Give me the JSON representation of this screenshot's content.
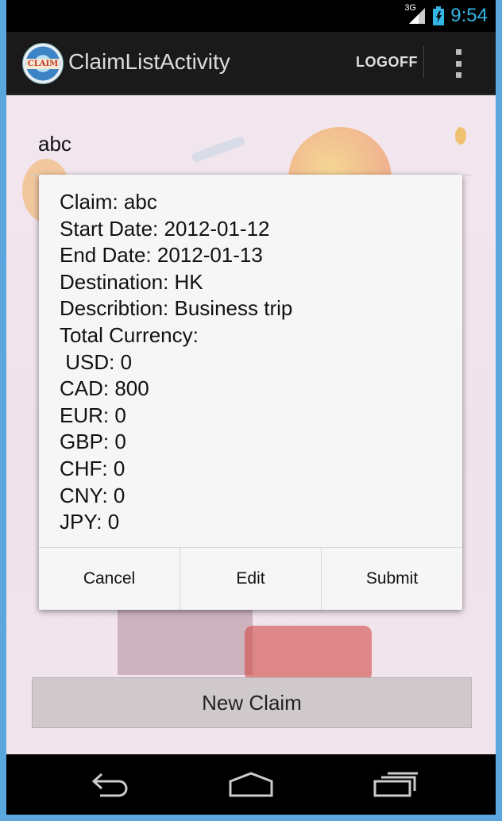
{
  "status_bar": {
    "network_label": "3G",
    "time": "9:54"
  },
  "action_bar": {
    "logo_text": "CLAIM",
    "title": "ClaimListActivity",
    "logoff_label": "LOGOFF"
  },
  "list": {
    "items": [
      {
        "label": "abc"
      }
    ]
  },
  "new_claim_label": "New Claim",
  "dialog": {
    "lines": [
      "Claim: abc",
      "Start Date: 2012-01-12",
      "End Date: 2012-01-13",
      "Destination: HK",
      "Describtion: Business trip",
      "Total Currency:",
      " USD: 0",
      "CAD: 800",
      "EUR: 0",
      "GBP: 0",
      "CHF: 0",
      "CNY: 0",
      "JPY: 0"
    ],
    "buttons": {
      "cancel": "Cancel",
      "edit": "Edit",
      "submit": "Submit"
    }
  },
  "colors": {
    "accent": "#33b5e5",
    "frame": "#5aa7e0"
  },
  "icons": [
    "signal-icon",
    "battery-icon",
    "overflow-menu-icon",
    "back-icon",
    "home-icon",
    "recent-apps-icon"
  ]
}
